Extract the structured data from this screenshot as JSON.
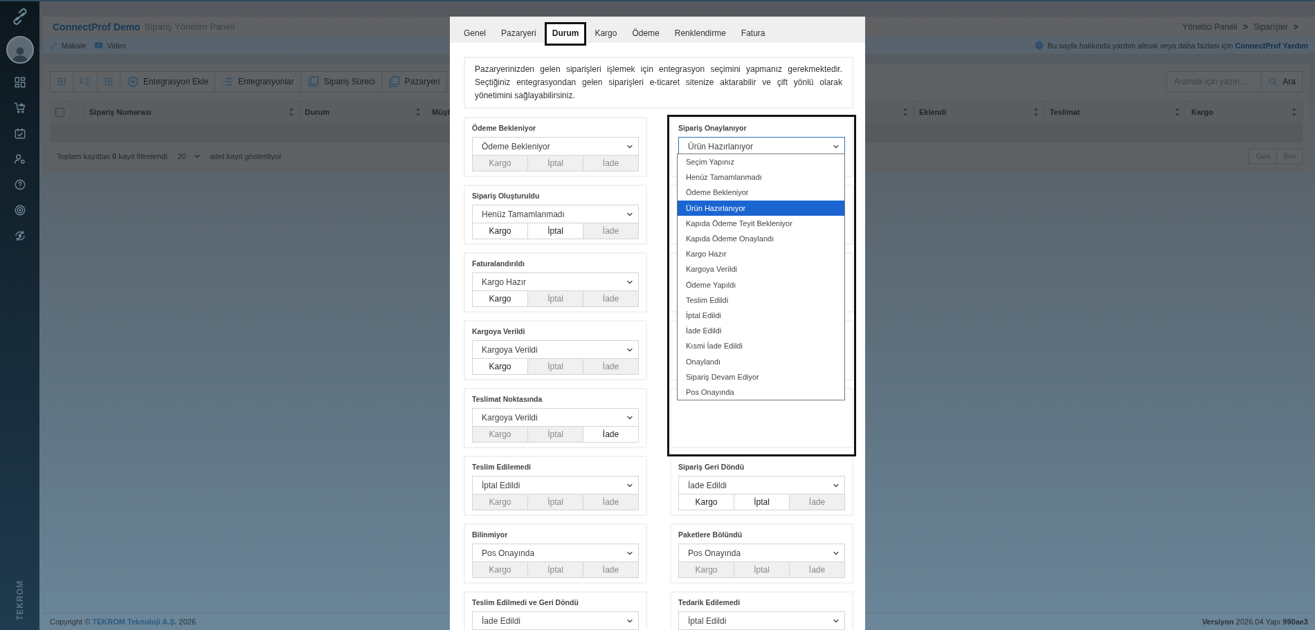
{
  "sidebar": {
    "brand": "TEKROM"
  },
  "header": {
    "title": "ConnectProf Demo",
    "subtitle": "Sipariş Yönetim Paneli",
    "breadcrumb": [
      {
        "label": "Yönetici Paneli",
        "separator": ">"
      },
      {
        "label": "Siparişler",
        "separator": ">"
      }
    ]
  },
  "links": [
    {
      "label": "Makale"
    },
    {
      "label": "Video"
    }
  ],
  "help": {
    "text": "Bu sayfa hakkında yardım almak veya daha fazlası için",
    "link": "ConnectProf Yardım"
  },
  "toolbar": {
    "buttons": [
      {
        "label": "Entegrasyon Ekle"
      },
      {
        "label": "Entegrasyonlar"
      },
      {
        "label": "Sipariş Süreci"
      },
      {
        "label": "Pazaryeri"
      }
    ]
  },
  "search": {
    "placeholder": "Aramak için yazın...",
    "button": "Ara"
  },
  "table": {
    "select_all": {
      "checked": false
    },
    "columns": [
      {
        "label": "Sipariş Numarası"
      },
      {
        "label": "Durum"
      },
      {
        "label": "Müşt"
      },
      {
        "label": "Eklendi"
      },
      {
        "label": "Teslimat"
      },
      {
        "label": "Kargo"
      }
    ]
  },
  "table_footer": {
    "summary": "Toplam kayıttan **0** kayıt filtrelendi.",
    "page_size": "20",
    "page_size_suffix": "adet kayıt gösteriliyor"
  },
  "pagination": [
    "Geri",
    "İleri"
  ],
  "footer": {
    "copyright": "Copyright ©",
    "company": "TEKROM Teknoloji A.Ş.",
    "year": "2026",
    "version": "**Versiyon** 2026.04 Yapı **990ae3**"
  },
  "modal": {
    "tabs": [
      {
        "label": "Genel",
        "selected": false
      },
      {
        "label": "Pazaryeri",
        "selected": false
      },
      {
        "label": "Durum",
        "selected": true
      },
      {
        "label": "Kargo",
        "selected": false
      },
      {
        "label": "Ödeme",
        "selected": false
      },
      {
        "label": "Renklendirme",
        "selected": false
      },
      {
        "label": "Fatura",
        "selected": false
      }
    ],
    "intro": "Pazaryerinizden gelen siparişleri işlemek için entegrasyon seçimini yapmanız gerekmektedir. Seçtiğiniz entegrasyondan gelen siparişleri e-ticaret sitenize aktarabilir ve çift yönlü olarak yönetimini sağlayabilirsiniz.",
    "left_cards": [
      {
        "title": "Ödeme Bekleniyor",
        "value": "Ödeme Bekleniyor",
        "actions": [
          {
            "label": "Kargo",
            "on": false
          },
          {
            "label": "İptal",
            "on": false
          },
          {
            "label": "İade",
            "on": false
          }
        ]
      },
      {
        "title": "Sipariş Oluşturuldu",
        "value": "Henüz Tamamlanmadı",
        "actions": [
          {
            "label": "Kargo",
            "on": true
          },
          {
            "label": "İptal",
            "on": true
          },
          {
            "label": "İade",
            "on": false
          }
        ]
      },
      {
        "title": "Faturalandırıldı",
        "value": "Kargo Hazır",
        "actions": [
          {
            "label": "Kargo",
            "on": true
          },
          {
            "label": "İptal",
            "on": false
          },
          {
            "label": "İade",
            "on": false
          }
        ]
      },
      {
        "title": "Kargoya Verildi",
        "value": "Kargoya Verildi",
        "actions": [
          {
            "label": "Kargo",
            "on": true
          },
          {
            "label": "İptal",
            "on": false
          },
          {
            "label": "İade",
            "on": false
          }
        ]
      },
      {
        "title": "Teslimat Noktasında",
        "value": "Kargoya Verildi",
        "actions": [
          {
            "label": "Kargo",
            "on": false
          },
          {
            "label": "İptal",
            "on": false
          },
          {
            "label": "İade",
            "on": true
          }
        ]
      },
      {
        "title": "Teslim Edilemedi",
        "value": "İptal Edildi",
        "actions": [
          {
            "label": "Kargo",
            "on": false
          },
          {
            "label": "İptal",
            "on": false
          },
          {
            "label": "İade",
            "on": false
          }
        ]
      },
      {
        "title": "Bilinmiyor",
        "value": "Pos Onayında",
        "actions": [
          {
            "label": "Kargo",
            "on": false
          },
          {
            "label": "İptal",
            "on": false
          },
          {
            "label": "İade",
            "on": false
          }
        ]
      },
      {
        "title": "Teslim Edilmedi ve Geri Döndü",
        "value": "İade Edildi"
      }
    ],
    "right_cards": [
      {
        "title": "Sipariş Onaylanıyor",
        "value": "Ürün Hazırlanıyor",
        "expanded": true,
        "options": [
          {
            "label": "Seçim Yapınız",
            "selected": false
          },
          {
            "label": "Henüz Tamamlanmadı",
            "selected": false
          },
          {
            "label": "Ödeme Bekleniyor",
            "selected": false
          },
          {
            "label": "Ürün Hazırlanıyor",
            "selected": true
          },
          {
            "label": "Kapıda Ödeme Teyit Bekleniyor",
            "selected": false
          },
          {
            "label": "Kapıda Ödeme Onaylandı",
            "selected": false
          },
          {
            "label": "Kargo Hazır",
            "selected": false
          },
          {
            "label": "Kargoya Verildi",
            "selected": false
          },
          {
            "label": "Ödeme Yapıldı",
            "selected": false
          },
          {
            "label": "Teslim Edildi",
            "selected": false
          },
          {
            "label": "İptal Edildi",
            "selected": false
          },
          {
            "label": "İade Edildi",
            "selected": false
          },
          {
            "label": "Kısmi İade Edildi",
            "selected": false
          },
          {
            "label": "Onaylandı",
            "selected": false
          },
          {
            "label": "Sipariş Devam Ediyor",
            "selected": false
          },
          {
            "label": "Pos Onayında",
            "selected": false
          }
        ]
      },
      {
        "title": "Sipariş Geri Döndü",
        "value": "İade Edildi",
        "actions": [
          {
            "label": "Kargo",
            "on": true
          },
          {
            "label": "İptal",
            "on": true
          },
          {
            "label": "İade",
            "on": false
          }
        ]
      },
      {
        "title": "Paketlere Bölündü",
        "value": "Pos Onayında",
        "actions": [
          {
            "label": "Kargo",
            "on": false
          },
          {
            "label": "İptal",
            "on": false
          },
          {
            "label": "İade",
            "on": false
          }
        ]
      },
      {
        "title": "Tedarik Edilemedi",
        "value": "İptal Edildi"
      }
    ]
  }
}
